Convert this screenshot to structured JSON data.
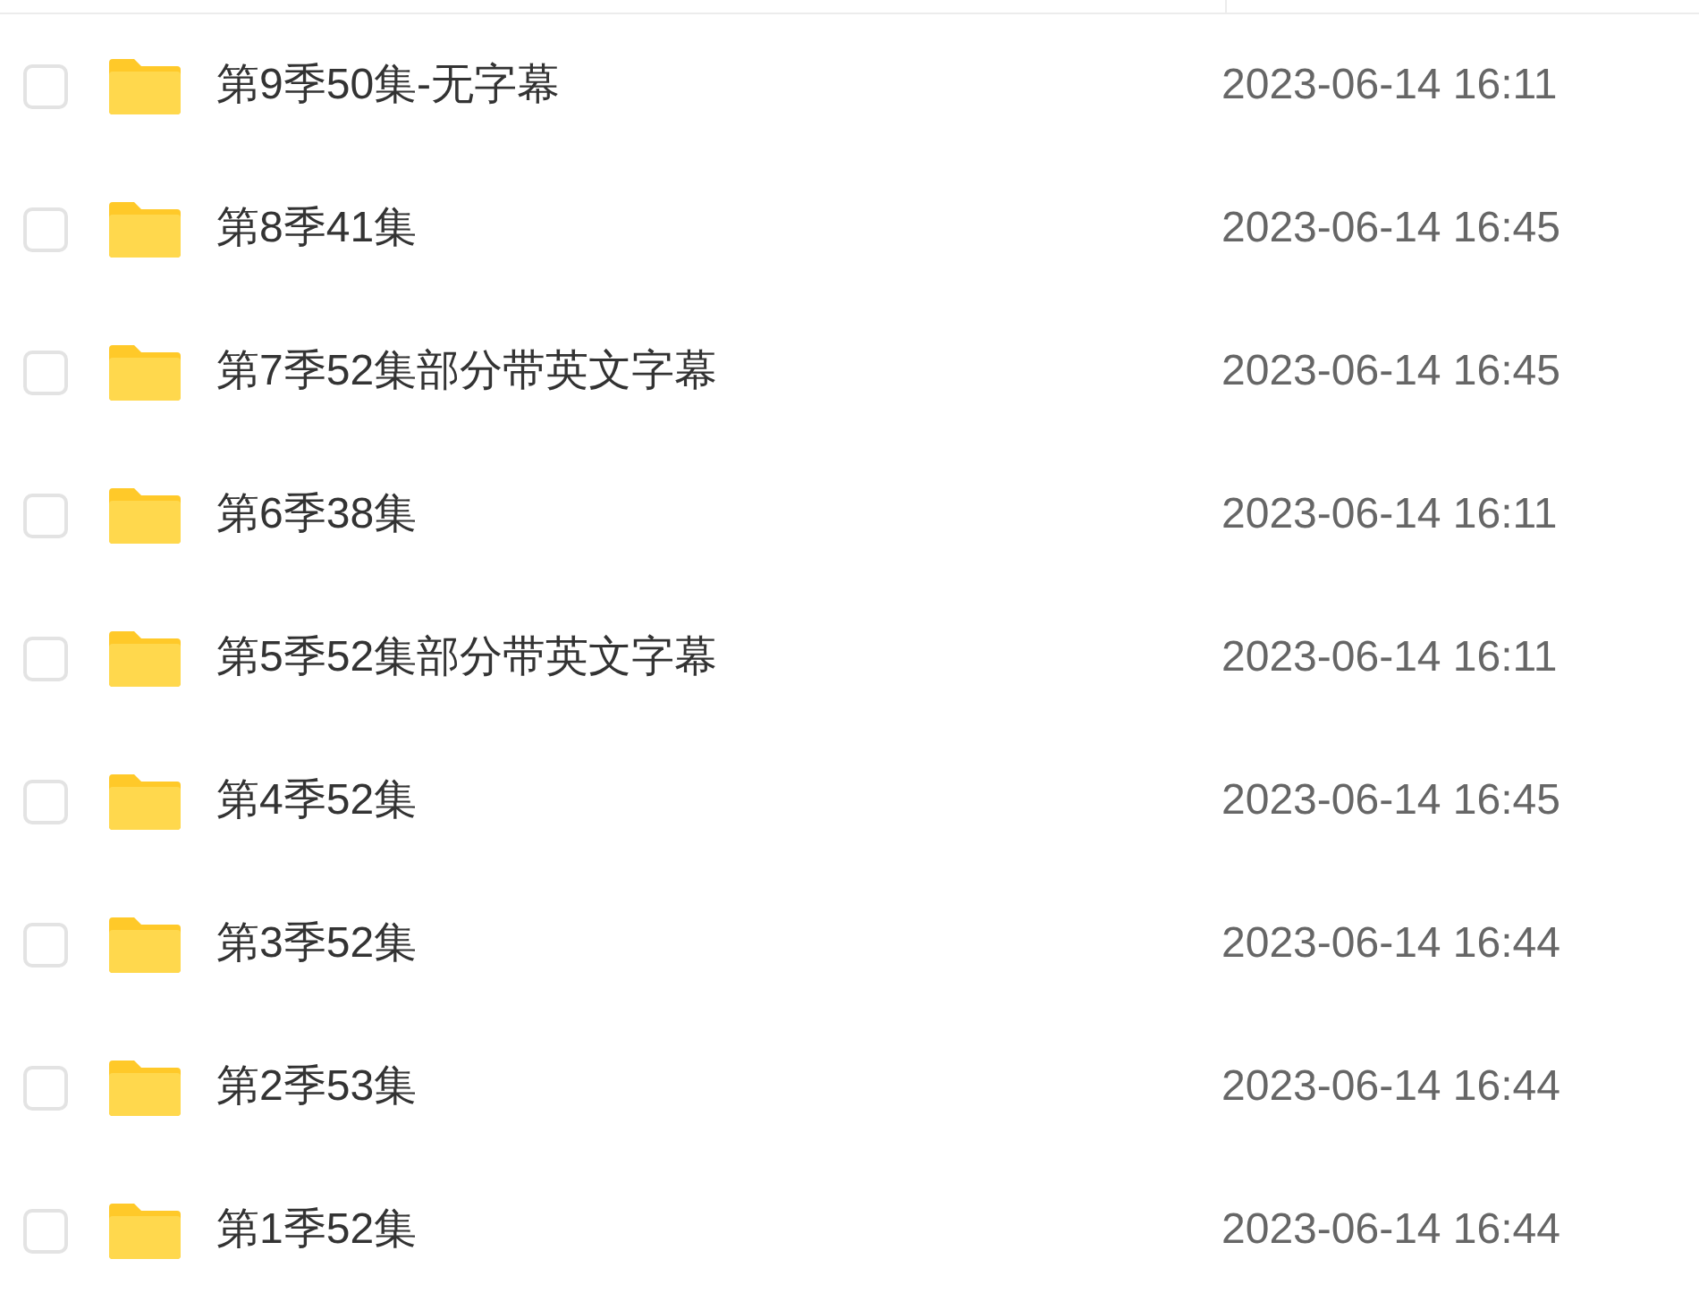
{
  "files": [
    {
      "name": "第9季50集-无字幕",
      "modified": "2023-06-14 16:11",
      "checked": false
    },
    {
      "name": "第8季41集",
      "modified": "2023-06-14 16:45",
      "checked": false
    },
    {
      "name": "第7季52集部分带英文字幕",
      "modified": "2023-06-14 16:45",
      "checked": false
    },
    {
      "name": "第6季38集",
      "modified": "2023-06-14 16:11",
      "checked": false
    },
    {
      "name": "第5季52集部分带英文字幕",
      "modified": "2023-06-14 16:11",
      "checked": false
    },
    {
      "name": "第4季52集",
      "modified": "2023-06-14 16:45",
      "checked": false
    },
    {
      "name": "第3季52集",
      "modified": "2023-06-14 16:44",
      "checked": false
    },
    {
      "name": "第2季53集",
      "modified": "2023-06-14 16:44",
      "checked": false
    },
    {
      "name": "第1季52集",
      "modified": "2023-06-14 16:44",
      "checked": false
    }
  ]
}
